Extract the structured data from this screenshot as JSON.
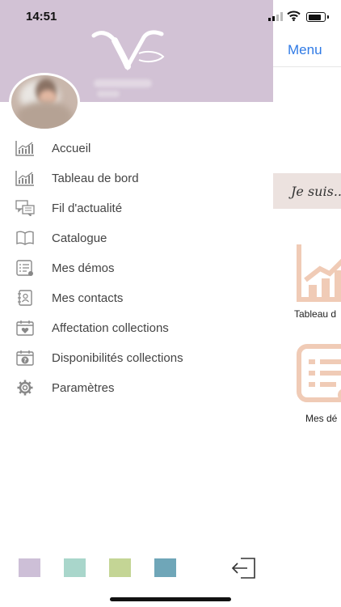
{
  "status_bar": {
    "time": "14:51"
  },
  "background_app": {
    "menu_button": "Menu",
    "banner_text": "Je suis...",
    "tiles": [
      {
        "label": "Tableau d"
      },
      {
        "label": "Mes dé"
      }
    ],
    "tile_icon_color": "#f0cbb6"
  },
  "drawer": {
    "header_color": "#d2c2d5",
    "menu": [
      {
        "label": "Accueil",
        "icon": "bar-chart-icon"
      },
      {
        "label": "Tableau de bord",
        "icon": "bar-chart-icon"
      },
      {
        "label": "Fil d'actualité",
        "icon": "chat-bubbles-icon"
      },
      {
        "label": "Catalogue",
        "icon": "open-book-icon"
      },
      {
        "label": "Mes démos",
        "icon": "document-list-icon"
      },
      {
        "label": "Mes contacts",
        "icon": "address-book-icon"
      },
      {
        "label": "Affectation collections",
        "icon": "calendar-heart-icon"
      },
      {
        "label": "Disponibilités collections",
        "icon": "calendar-question-icon"
      },
      {
        "label": "Paramètres",
        "icon": "gear-icon"
      }
    ],
    "swatches": [
      "#cdbfd7",
      "#a9d6cb",
      "#c4d595",
      "#6fa6b8"
    ]
  }
}
